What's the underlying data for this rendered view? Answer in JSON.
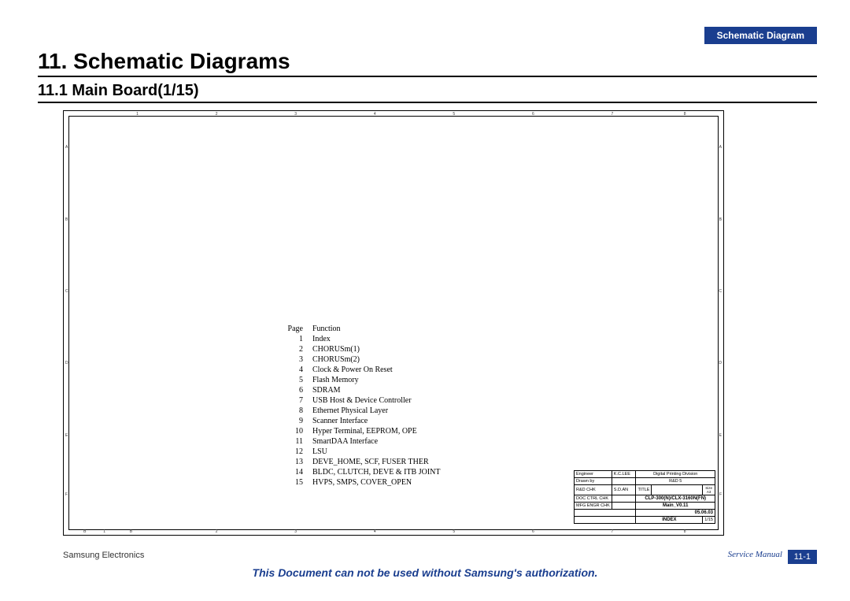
{
  "header_tab": "Schematic Diagram",
  "heading": "11.  Schematic Diagrams",
  "subheading": "11.1  Main Board(1/15)",
  "index": {
    "header": {
      "page": "Page",
      "function": "Function"
    },
    "rows": [
      {
        "page": "1",
        "function": "Index"
      },
      {
        "page": "2",
        "function": "CHORUSm(1)"
      },
      {
        "page": "3",
        "function": "CHORUSm(2)"
      },
      {
        "page": "4",
        "function": "Clock & Power On Reset"
      },
      {
        "page": "5",
        "function": "Flash Memory"
      },
      {
        "page": "6",
        "function": "SDRAM"
      },
      {
        "page": "7",
        "function": "USB Host & Device Controller"
      },
      {
        "page": "8",
        "function": "Ethernet Physical Layer"
      },
      {
        "page": "9",
        "function": "Scanner Interface"
      },
      {
        "page": "10",
        "function": "Hyper Terminal, EEPROM, OPE"
      },
      {
        "page": "11",
        "function": "SmartDAA Interface"
      },
      {
        "page": "12",
        "function": "LSU"
      },
      {
        "page": "13",
        "function": "DEVE_HOME, SCF, FUSER THER"
      },
      {
        "page": "14",
        "function": "BLDC, CLUTCH, DEVE & ITB JOINT"
      },
      {
        "page": "15",
        "function": "HVPS, SMPS, COVER_OPEN"
      }
    ]
  },
  "title_block": {
    "engineer_label": "Engineer",
    "engineer": "K.C.LEE",
    "division": "Digital Printing Division",
    "drawn_label": "Drawn by",
    "group": "R&D 5",
    "rnd_chk_label": "R&D CHK",
    "rnd_chk": "S.D.AN",
    "title_label": "TITLE",
    "size_label": "Size",
    "size": "A3",
    "doc_ctrl_label": "DOC CTRL CHK",
    "title1": "CLP-300(N)/CLX-3160N(FN)",
    "mfg_chk_label": "MFG ENGR CHK",
    "title2": "Main_V0.11",
    "date": "05.06.03",
    "index_label": "INDEX",
    "sheet": "1/15"
  },
  "footer": {
    "company": "Samsung Electronics",
    "notice": "This Document can not be used without Samsung's authorization.",
    "service": "Service Manual",
    "page_num": "11-1"
  },
  "frame": {
    "cols": [
      "1",
      "2",
      "3",
      "4",
      "5",
      "6",
      "7",
      "8"
    ],
    "rows": [
      "A",
      "B",
      "C",
      "D",
      "E",
      "F"
    ],
    "bottom_cols": [
      "B",
      "1",
      "B",
      "2",
      "3",
      "4",
      "5",
      "6",
      "7",
      "8"
    ]
  }
}
